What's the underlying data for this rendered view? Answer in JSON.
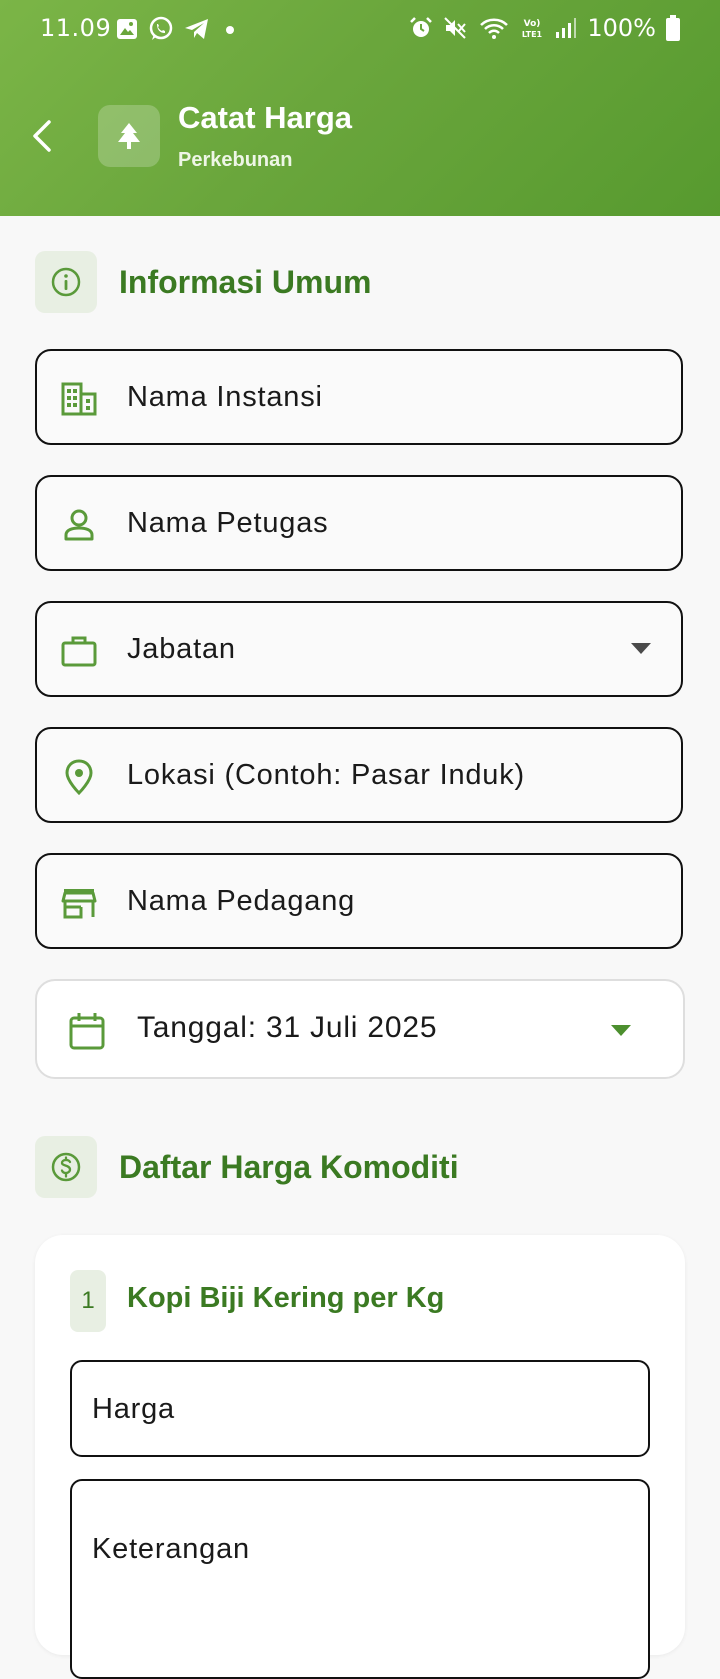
{
  "status_bar": {
    "time": "11.09",
    "battery": "100%",
    "left_icons": [
      "gallery-icon",
      "whatsapp-icon",
      "telegram-icon",
      "dot-icon"
    ],
    "right_icons": [
      "alarm-icon",
      "mute-icon",
      "wifi-icon",
      "volte-icon",
      "signal-icon",
      "battery-icon"
    ]
  },
  "header": {
    "title": "Catat Harga",
    "subtitle": "Perkebunan",
    "back_icon": "chevron-left-icon",
    "app_icon": "tree-icon"
  },
  "section_general": {
    "title": "Informasi Umum",
    "icon": "info-icon"
  },
  "fields": {
    "instansi": {
      "label": "Nama Instansi",
      "icon": "building-icon"
    },
    "petugas": {
      "label": "Nama Petugas",
      "icon": "person-icon"
    },
    "jabatan": {
      "label": "Jabatan",
      "icon": "briefcase-icon"
    },
    "lokasi": {
      "label": "Lokasi (Contoh: Pasar Induk)",
      "icon": "location-pin-icon"
    },
    "pedagang": {
      "label": "Nama Pedagang",
      "icon": "store-icon"
    },
    "tanggal": {
      "label": "Tanggal: 31 Juli 2025",
      "icon": "calendar-icon"
    }
  },
  "section_prices": {
    "title": "Daftar Harga Komoditi",
    "icon": "dollar-circle-icon"
  },
  "commodities": [
    {
      "number": "1",
      "name": "Kopi Biji Kering per Kg",
      "price_label": "Harga",
      "note_label": "Keterangan"
    }
  ],
  "colors": {
    "header_gradient_start": "#7bb547",
    "header_gradient_end": "#579a2f",
    "accent_green": "#3b7a22",
    "icon_green": "#5a9a3a",
    "section_icon_bg": "#e8efe3"
  }
}
